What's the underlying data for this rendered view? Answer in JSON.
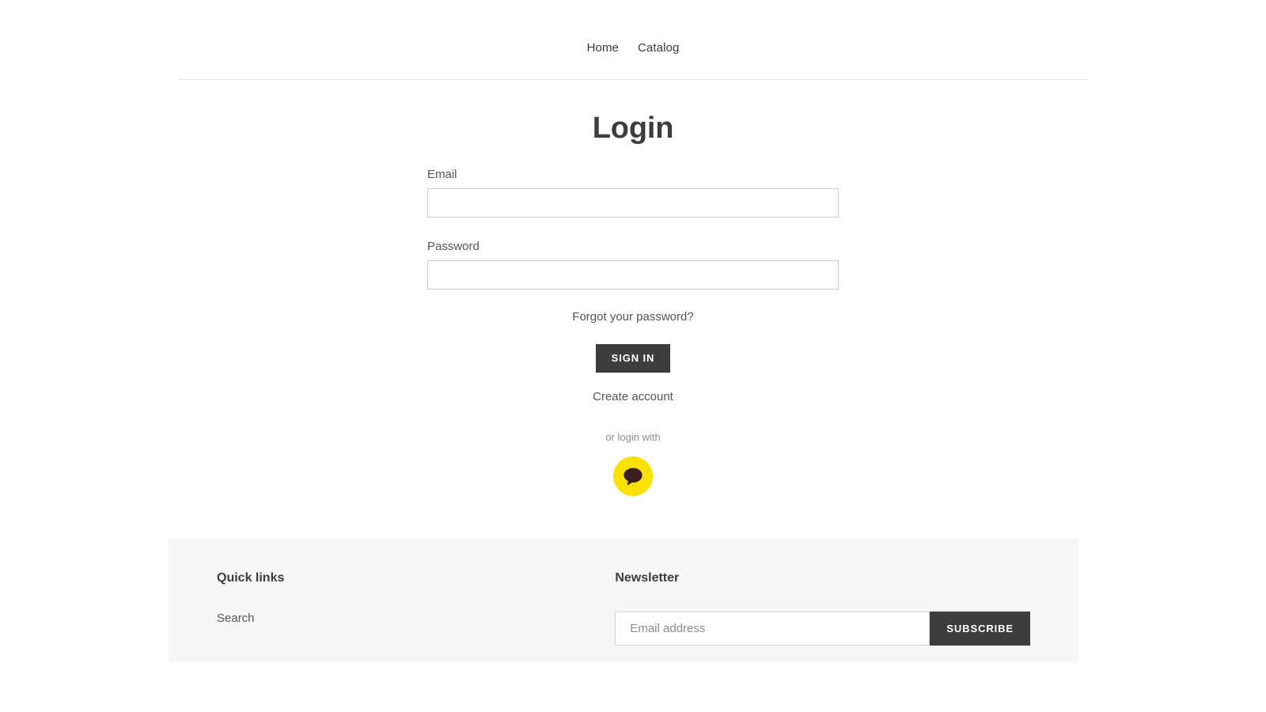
{
  "header": {
    "nav": [
      {
        "label": "Home",
        "name": "nav-link-home"
      },
      {
        "label": "Catalog",
        "name": "nav-link-catalog"
      }
    ]
  },
  "main": {
    "title": "Login",
    "form": {
      "email_label": "Email",
      "email_value": "",
      "email_placeholder": "",
      "password_label": "Password",
      "password_value": "",
      "password_placeholder": "",
      "forgot_password_label": "Forgot your password?",
      "submit_label": "SIGN IN",
      "create_account_label": "Create account"
    },
    "social": {
      "caption": "or login with",
      "providers": [
        {
          "name": "kakao-login-button",
          "icon": "speech-bubble-icon",
          "color": "#FAE100",
          "glyph_color": "#3C1E1E"
        }
      ]
    }
  },
  "footer": {
    "quick_links": {
      "heading": "Quick links",
      "items": [
        {
          "label": "Search",
          "name": "footer-link-search"
        }
      ]
    },
    "newsletter": {
      "heading": "Newsletter",
      "input_placeholder": "Email address",
      "input_value": "",
      "subscribe_label": "SUBSCRIBE"
    }
  },
  "theme": {
    "accent_dark": "#3d3d3d",
    "footer_bg": "#f6f6f6",
    "border": "#cccccc",
    "kakao_yellow": "#FAE100"
  }
}
